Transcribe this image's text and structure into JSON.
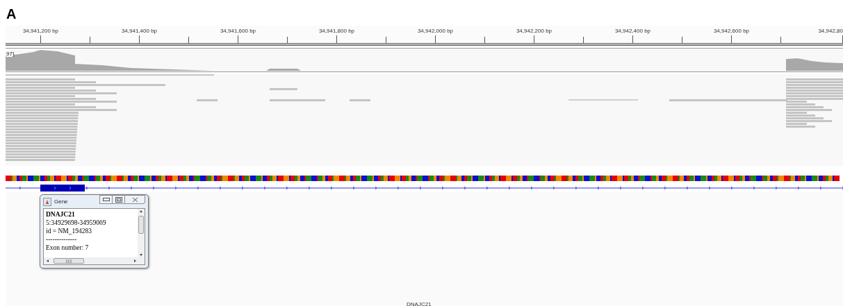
{
  "figure_label": "A",
  "ruler": {
    "ticks": [
      "34,941,200 bp",
      "34,941,400 bp",
      "34,941,600 bp",
      "34,941,800 bp",
      "34,942,000 bp",
      "34,942,200 bp",
      "34,942,400 bp",
      "34,942,600 bp",
      "34,942,80"
    ]
  },
  "coverage_track": {
    "range_label": "97]"
  },
  "gene_popup": {
    "title": "Gene",
    "lines": [
      {
        "text": "DNAJC21",
        "kind": "name"
      },
      {
        "text": "5:34929698-34959069",
        "kind": "plain"
      },
      {
        "text": "id = NM_194283",
        "kind": "plain"
      },
      {
        "text": "--------------",
        "kind": "plain"
      },
      {
        "text": "Exon number: 7",
        "kind": "plain"
      }
    ]
  },
  "gene_track": {
    "gene_label": "DNAJC21"
  }
}
